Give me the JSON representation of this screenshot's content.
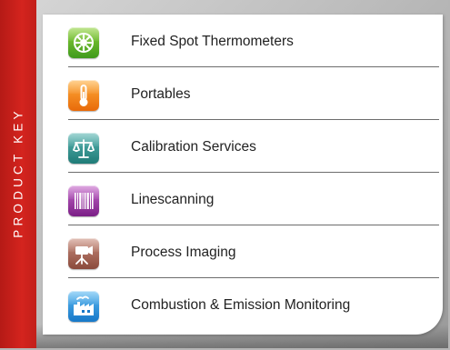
{
  "side_label": "PRODUCT KEY",
  "items": [
    {
      "label": "Fixed Spot Thermometers",
      "icon": "sun-target-icon",
      "color": "#56b02a"
    },
    {
      "label": "Portables",
      "icon": "thermometer-icon",
      "color": "#f58a1f"
    },
    {
      "label": "Calibration Services",
      "icon": "scales-icon",
      "color": "#2e938f"
    },
    {
      "label": "Linescanning",
      "icon": "barcode-icon",
      "color": "#9b3aa5"
    },
    {
      "label": "Process Imaging",
      "icon": "camera-tripod-icon",
      "color": "#a8624f"
    },
    {
      "label": "Combustion & Emission Monitoring",
      "icon": "factory-icon",
      "color": "#2896e0"
    }
  ],
  "colors": {
    "strip": "#d4241e",
    "card": "#ffffff",
    "background": "#b5b5b5"
  }
}
